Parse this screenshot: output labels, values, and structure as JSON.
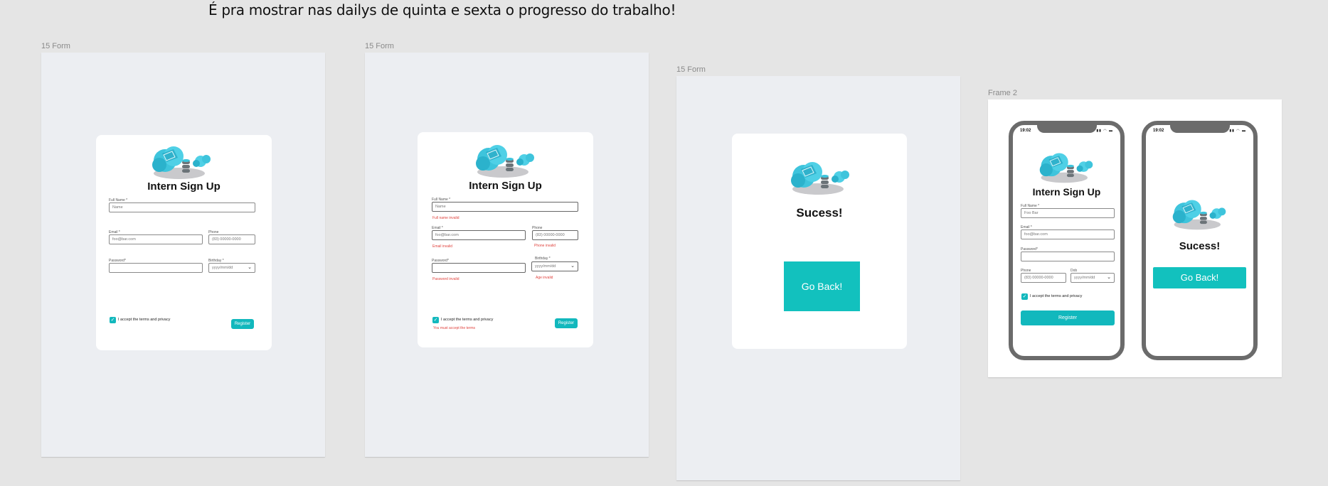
{
  "page": {
    "note": "É pra mostrar nas dailys de quinta e sexta o progresso do trabalho!"
  },
  "frames": {
    "f1_label": "15 Form",
    "f2_label": "15 Form",
    "f3_label": "15 Form",
    "f4_label": "Frame 2"
  },
  "form": {
    "title": "Intern Sign Up",
    "full_name_label": "Full Name *",
    "full_name_placeholder": "Name",
    "email_label": "Email *",
    "email_placeholder": "foo@bar.com",
    "phone_label": "Phone",
    "phone_placeholder": "(83) 00000-0000",
    "password_label": "Password*",
    "birthday_label": "Birthday *",
    "birthday_placeholder": "yyyy/mm/dd",
    "terms_label": "I accept the terms and privacy",
    "register_label": "Register"
  },
  "errors": {
    "full_name": "Full name invalid",
    "email": "Email invalid",
    "phone": "Phone invalid",
    "password": "Password invalid",
    "age": "Age invalid",
    "terms": "You must accept the terms"
  },
  "success": {
    "title": "Sucess!",
    "button": "Go Back!"
  },
  "mobile": {
    "time": "19:02",
    "full_name_value": "Foo Bar",
    "email_value": "foo@bar.com",
    "phone_label": "Phone",
    "phone_placeholder": "(83) 00000-0000",
    "dob_label": "Dob",
    "dob_placeholder": "yyyy/mm/dd",
    "register_label": "Register"
  },
  "colors": {
    "accent": "#12b8bd",
    "error": "#e0443f",
    "canvas": "#e5e5e5",
    "frame": "#eceef2"
  },
  "icons": [
    "cloud-database-logo",
    "check-icon",
    "chevron-down-icon",
    "signal-icon",
    "wifi-icon",
    "battery-icon"
  ]
}
